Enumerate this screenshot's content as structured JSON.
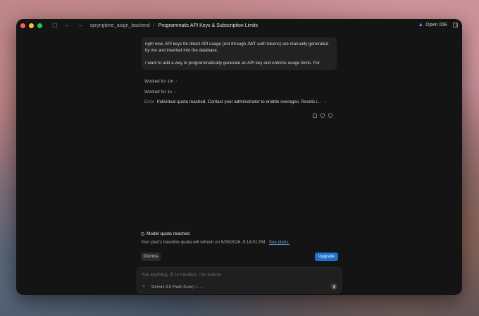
{
  "window": {
    "breadcrumb_project": "spryngtime_asign_backend",
    "breadcrumb_separator": "/",
    "breadcrumb_title": "Programmatic API Keys & Subscription Limits",
    "open_ide_label": "Open IDE"
  },
  "icons": {
    "sidebar_toggle": "sidebar-icon",
    "back": "back-arrow-icon",
    "forward": "forward-arrow-icon",
    "ide_logo": "antigravity-logo-icon",
    "layout": "panel-layout-icon",
    "copy": "copy-icon",
    "thumbs_up": "thumbs-up-icon",
    "thumbs_down": "thumbs-down-icon",
    "info": "info-circle-icon",
    "plus": "plus-icon",
    "mic": "microphone-icon",
    "chevron": "chevron-right-icon"
  },
  "chat": {
    "user_message_line1": "right now, API keys for direct API usage (not through JWT auth tokens) are manually generated by me and inserted into the database.",
    "user_message_line2": "I want to add a way to programmatically generate an API key and enforce usage limits. For",
    "worked_1": "Worked for 1m",
    "worked_2": "Worked for 1s",
    "error_label": "Error",
    "error_text": "Individual quota reached. Contact your administrator to enable overages. Resets i..."
  },
  "quota": {
    "title": "Model quota reached",
    "description": "Your plan's baseline quota will refresh on 5/28/2026, 9:14:01 PM.",
    "link_label": "See plans.",
    "dismiss_label": "Dismiss",
    "upgrade_label": "Upgrade"
  },
  "composer": {
    "placeholder": "Ask anything, @ to mention, / for actions",
    "model_label": "Gemini 3.5 Flash (Low)"
  },
  "colors": {
    "accent": "#1f6fd1",
    "link": "#6b9bd8",
    "window_bg": "#141414"
  }
}
